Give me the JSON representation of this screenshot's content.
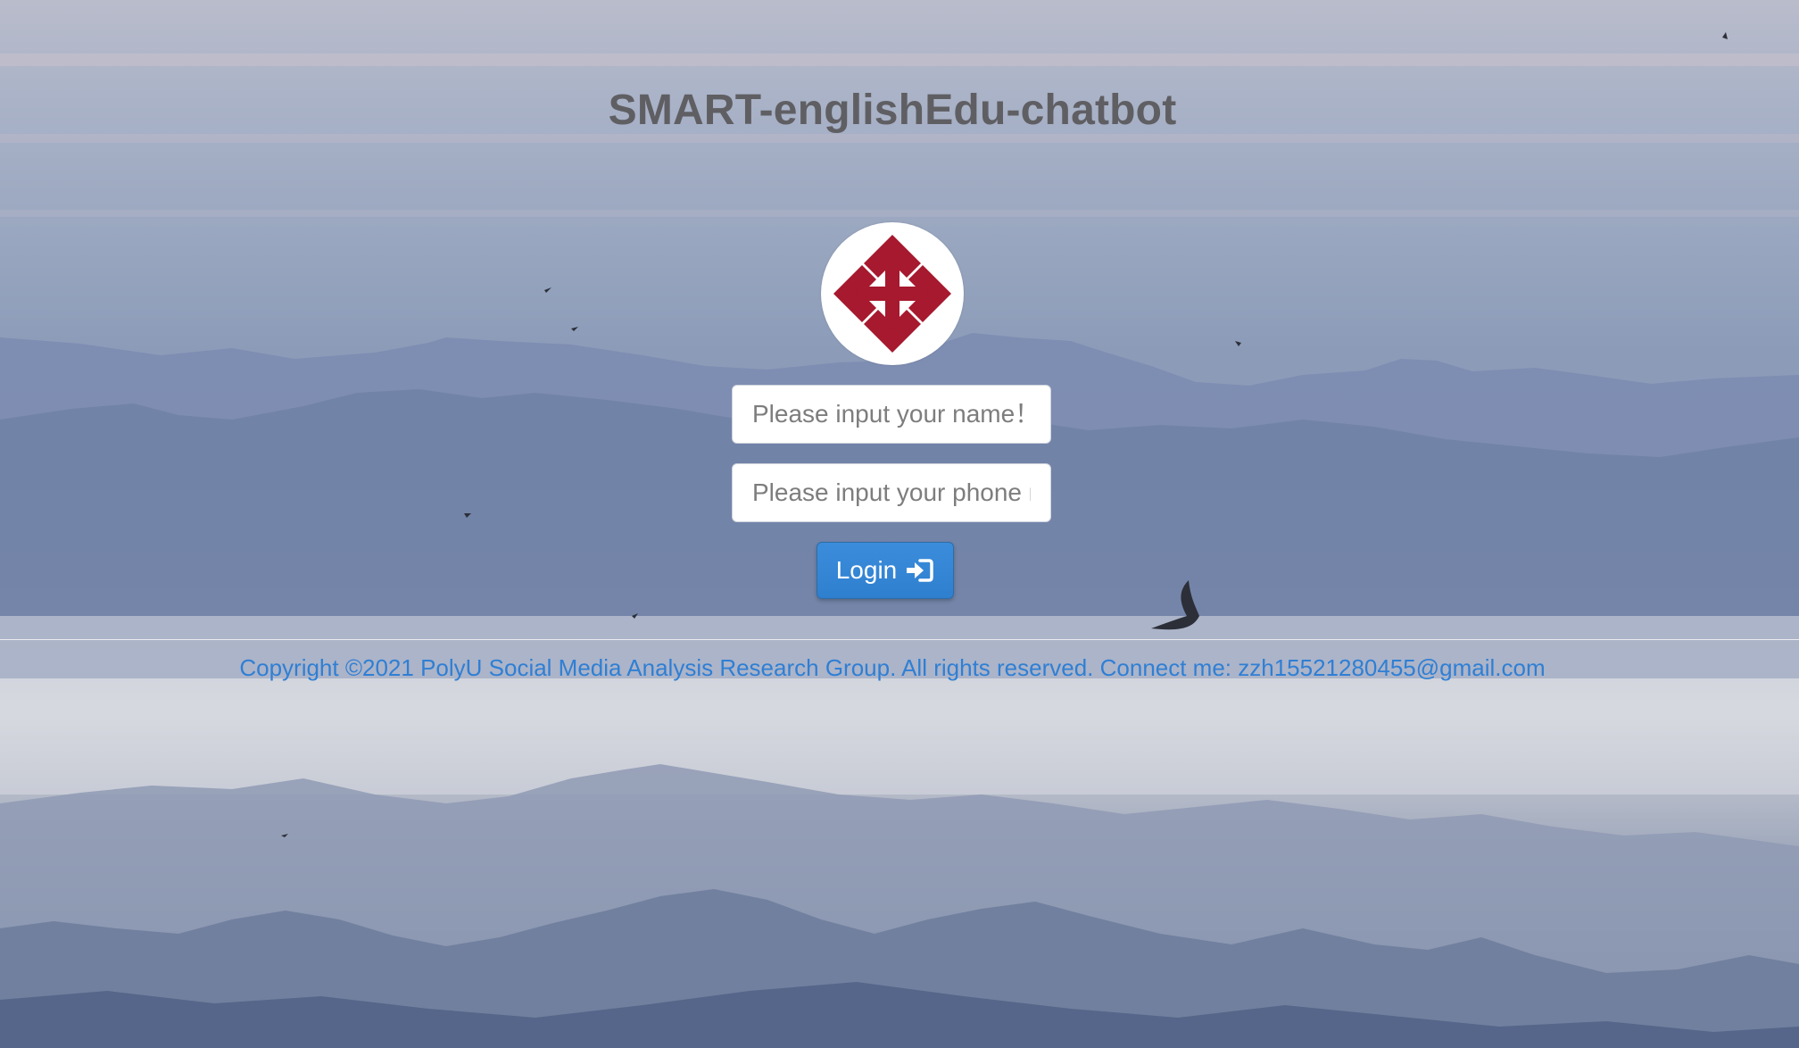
{
  "app": {
    "title": "SMART-englishEdu-chatbot"
  },
  "logo": {
    "icon": "polyu-logo-icon",
    "color": "#a6192e"
  },
  "form": {
    "name_placeholder": "Please input your name！",
    "phone_placeholder": "Please input your phone number！",
    "login_label": "Login",
    "login_icon": "login-arrow-icon",
    "login_color": "#337ab7"
  },
  "footer": {
    "copyright": "Copyright ©2021 PolyU Social Media Analysis Research Group. All rights reserved. Connect me: zzh15521280455@gmail.com",
    "text_color": "#2f7fd4"
  }
}
